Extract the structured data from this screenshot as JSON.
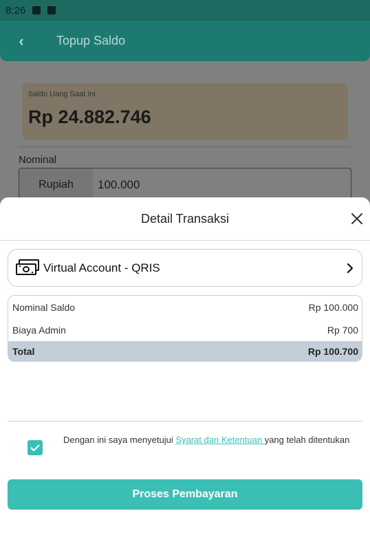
{
  "status_bar": {
    "time": "8:26"
  },
  "app_bar": {
    "title": "Topup Saldo"
  },
  "balance_card": {
    "label": "Saldo Uang Saat Ini",
    "value": "Rp 24.882.746"
  },
  "nominal": {
    "label": "Nominal",
    "prefix": "Rupiah",
    "value": "100.000"
  },
  "sheet": {
    "title": "Detail Transaksi",
    "payment_method": "Virtual Account - QRIS",
    "summary": [
      {
        "label": "Nominal Saldo",
        "value": "Rp 100.000"
      },
      {
        "label": "Biaya Admin",
        "value": "Rp 700"
      }
    ],
    "total": {
      "label": "Total",
      "value": "Rp 100.700"
    },
    "agreement": {
      "checked": true,
      "prefix": "Dengan ini saya menyetujui ",
      "link": "Syarat dan Ketentuan ",
      "suffix": "yang telah ditentukan"
    },
    "button_label": "Proses Pembayaran"
  },
  "colors": {
    "accent": "#3bbfb4",
    "appbar": "#1d7a70",
    "total_row": "#c4ced8"
  },
  "icons": [
    "back-arrow-icon",
    "close-icon",
    "cash-icon",
    "chevron-right-icon",
    "check-icon"
  ]
}
